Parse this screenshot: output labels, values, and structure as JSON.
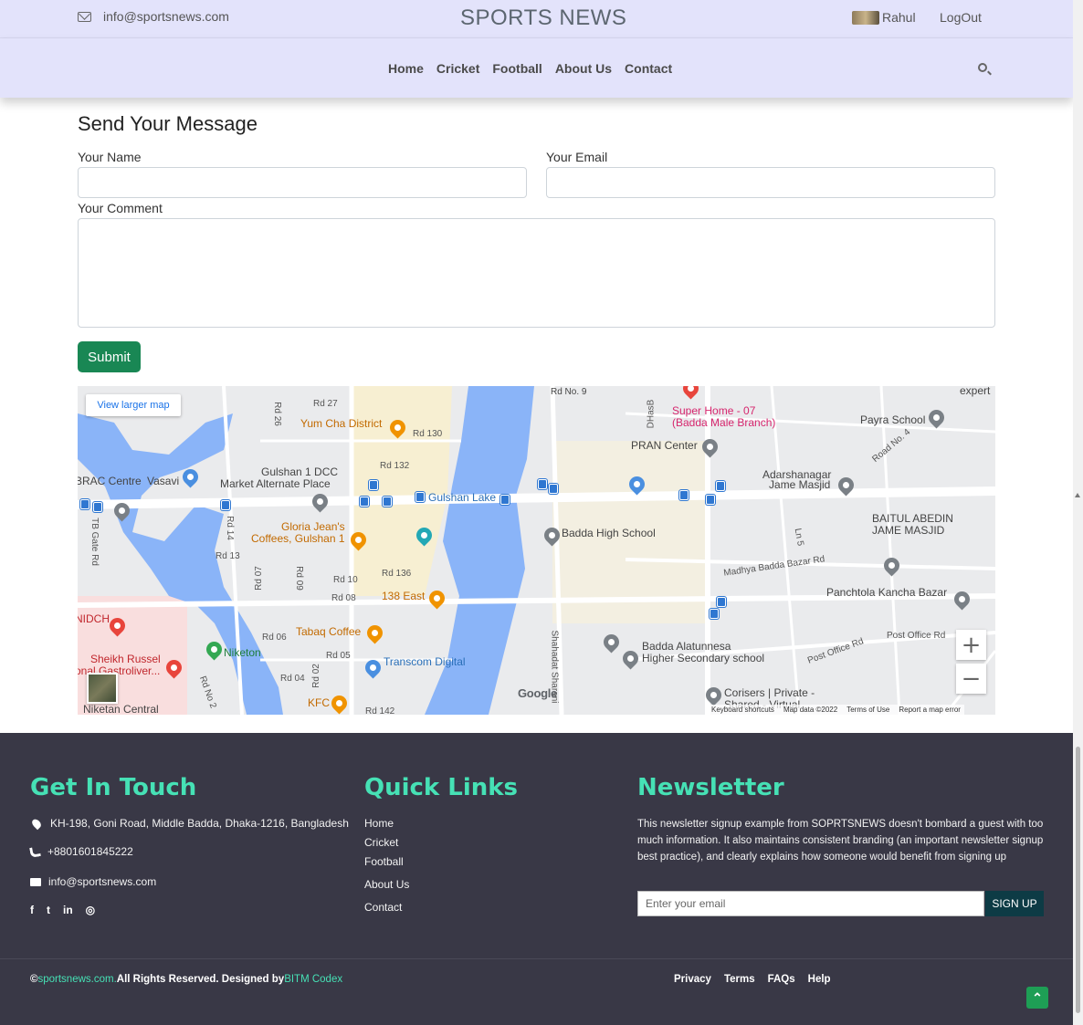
{
  "header": {
    "email": "info@sportsnews.com",
    "brand": "SPORTS NEWS",
    "user_name": "Rahul",
    "logout": "LogOut"
  },
  "nav": {
    "links": [
      "Home",
      "Cricket",
      "Football",
      "About Us",
      "Contact"
    ]
  },
  "form": {
    "title": "Send Your Message",
    "name_label": "Your Name",
    "email_label": "Your Email",
    "comment_label": "Your Comment",
    "name_value": "",
    "email_value": "",
    "comment_value": "",
    "submit": "Submit"
  },
  "map": {
    "view_larger": "View larger map",
    "labels": {
      "rd_no9": "Rd No. 9",
      "expert": "expert",
      "super_home": "Super Home - 07",
      "super_home2": "(Badda Male Branch)",
      "payra": "Payra School",
      "yum_cha": "Yum Cha District",
      "rd27": "Rd 27",
      "rd26": "Rd 26",
      "rd130": "Rd 130",
      "pran": "PRAN Center",
      "road_no4": "Road No. 4",
      "rd132": "Rd 132",
      "gulshan1dcc": "Gulshan 1 DCC",
      "market_alt": "Market Alternate Place",
      "brac": "BRAC Centre",
      "vasavi": "Vasavi",
      "gulshan_lake": "Gulshan Lake",
      "adarsha": "Adarshanagar",
      "jame": "Jame Masjid",
      "baitul": "BAITUL ABEDIN",
      "baitul2": "JAME MASJID",
      "gloria": "Gloria Jean's",
      "gloria2": "Coffees, Gulshan 1",
      "badda_high": "Badda High School",
      "madhya": "Madhya Badda Bazar Rd",
      "rd13": "Rd 13",
      "rd14": "Rd 14",
      "tb_gate": "TB Gate Rd",
      "rd136": "Rd 136",
      "rd10": "Rd 10",
      "rd08": "Rd 08",
      "rd07": "Rd 07",
      "rd09": "Rd 09",
      "east138": "138 East",
      "panchtola": "Panchtola Kancha Bazar",
      "ln5": "Ln 5",
      "niidch": "NIDCH",
      "tabaq": "Tabaq Coffee",
      "rd06": "Rd 06",
      "rd05": "Rd 05",
      "niketon": "Niketon",
      "sheikh": "Sheikh Russel",
      "sheikh2": "onal Gastroliver...",
      "transcom": "Transcom Digital",
      "badda_alat": "Badda Alatunnesa",
      "badda_alat2": "Higher Secondary school",
      "post_office": "Post Office Rd",
      "post_office2": "Post Office Rd",
      "rd04": "Rd 04",
      "rd02": "Rd 02",
      "rd_no2": "Rd No 2",
      "shahadat": "Shahadat Sharani",
      "kfc": "KFC",
      "corisers": "Corisers | Private -",
      "corisers2": "Shared - Virtual",
      "niketan": "Niketan Central",
      "rd142": "Rd 142",
      "dhasb": "DHasB"
    },
    "google": "Google",
    "attribution": [
      "Keyboard shortcuts",
      "Map data ©2022",
      "Terms of Use",
      "Report a map error"
    ],
    "zoom_in": "+",
    "zoom_out": "−"
  },
  "footer": {
    "contact_title": "Get In Touch",
    "address": "KH-198, Goni Road, Middle Badda, Dhaka-1216, Bangladesh",
    "phone": "+8801601845222",
    "email": "info@sportsnews.com",
    "social": [
      "f",
      "t",
      "in",
      "ig"
    ],
    "links_title": "Quick Links",
    "links": [
      "Home",
      "Cricket",
      "Football",
      "About Us",
      "Contact"
    ],
    "newsletter_title": "Newsletter",
    "newsletter_text": "This newsletter signup example from SOPRTSNEWS doesn't bombard a guest with too much information. It also maintains consistent branding (an important newsletter signup best practice), and clearly explains how someone would benefit from signing up",
    "newsletter_placeholder": "Enter your email",
    "newsletter_button": "SIGN UP",
    "copyright_prefix": "©",
    "copyright_site": "sportsnews.com.",
    "copyright_mid": "All Rights Reserved. Designed by",
    "copyright_designer": "BITM Codex",
    "bottom_links": [
      "Privacy",
      "Terms",
      "FAQs",
      "Help"
    ]
  },
  "colors": {
    "header_bg": "#e3e3fb",
    "footer_bg": "#393846",
    "accent": "#46e1b5",
    "submit": "#198754",
    "signup": "#0d3b45"
  }
}
